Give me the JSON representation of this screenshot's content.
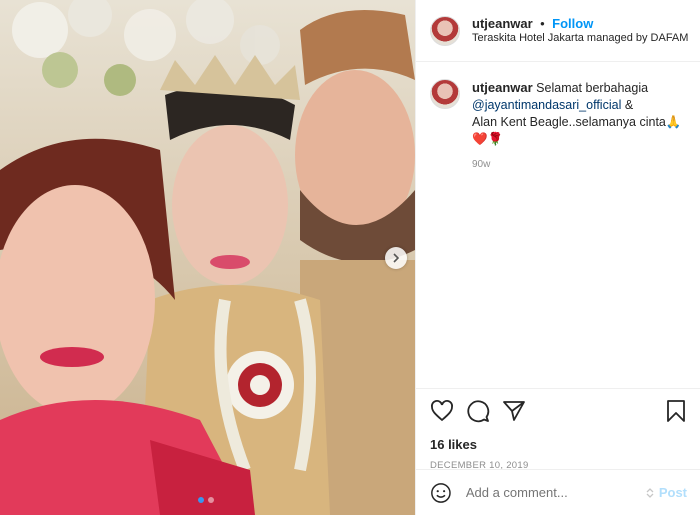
{
  "post": {
    "username": "utjeanwar",
    "separator": "•",
    "follow_label": "Follow",
    "location": "Teraskita Hotel Jakarta managed by DAFAM"
  },
  "caption": {
    "username": "utjeanwar",
    "text_start": "Selamat berbahagia",
    "mention": "@jayantimandasari_official",
    "text_amp": "&",
    "text_end": "Alan Kent Beagle..selamanya cinta🙏",
    "emojis": "❤️🌹",
    "age": "90w"
  },
  "engagement": {
    "likes": "16 likes",
    "date": "DECEMBER 10, 2019"
  },
  "comment_box": {
    "placeholder": "Add a comment...",
    "post_label": "Post"
  },
  "carousel": {
    "slide_count": 2,
    "active_index": 0
  },
  "icons": {
    "like": "heart-icon",
    "comment": "comment-icon",
    "share": "share-icon",
    "save": "bookmark-icon",
    "emoji": "emoji-icon",
    "next": "chevron-right-icon"
  },
  "colors": {
    "follow": "#0095f6",
    "post_disabled": "#b2dffc",
    "mention": "#00376b",
    "muted": "#8e8e8e"
  }
}
